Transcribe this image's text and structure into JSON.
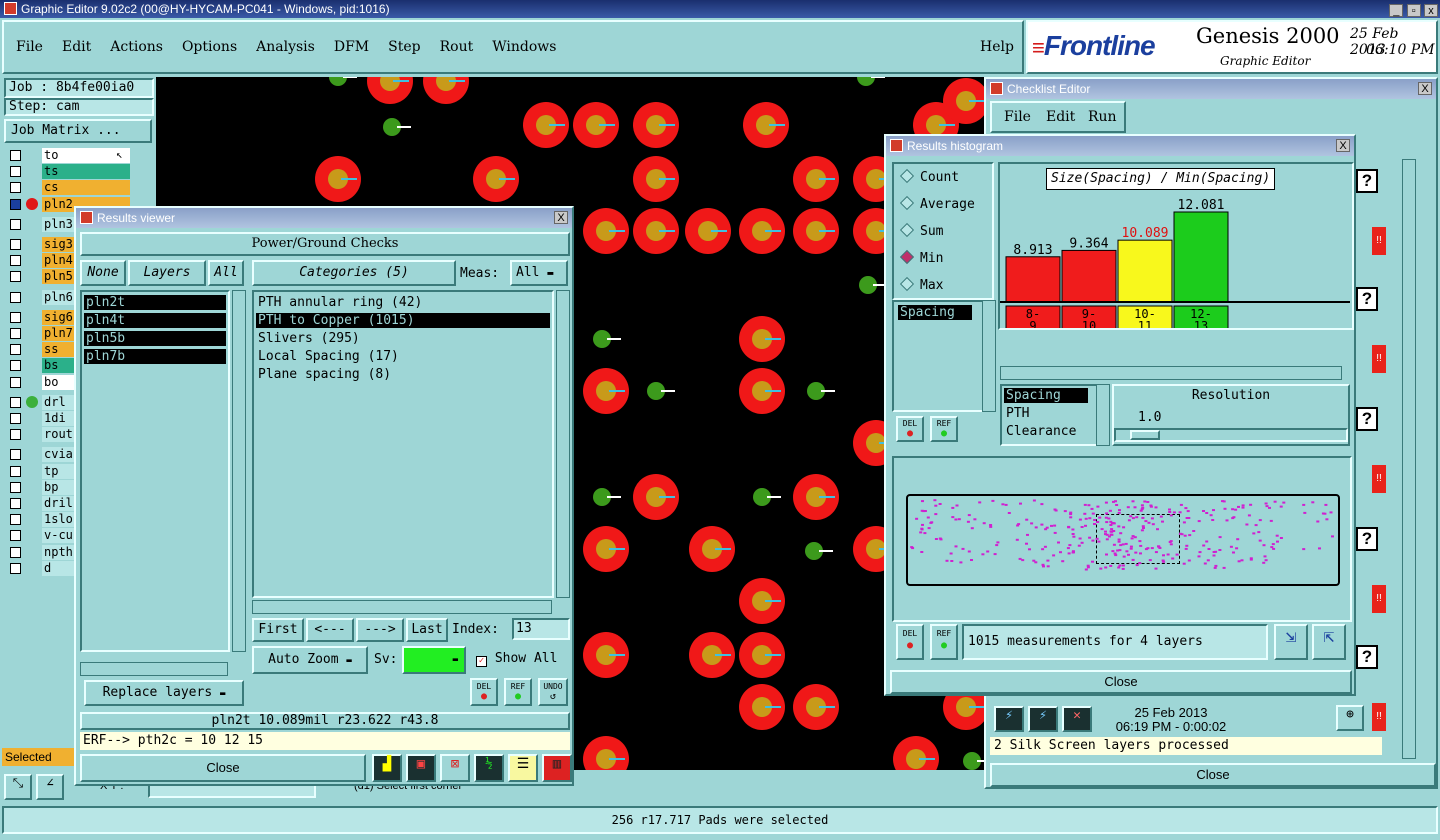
{
  "app": {
    "title": "Graphic Editor 9.02c2 (00@HY-HYCAM-PC041 - Windows, pid:1016)",
    "menu": [
      "File",
      "Edit",
      "Actions",
      "Options",
      "Analysis",
      "DFM",
      "Step",
      "Rout",
      "Windows"
    ],
    "help": "Help",
    "brand": "Frontline",
    "product": "Genesis 2000",
    "product_sub": "Graphic Editor",
    "date": "25 Feb 2013",
    "time": "06:10 PM"
  },
  "left_panel": {
    "job": "Job : 8b4fe00ia0",
    "step": "Step: cam",
    "job_matrix": "Job Matrix ...",
    "layers": [
      {
        "name": "to",
        "color": "#ffffff"
      },
      {
        "name": "ts",
        "color": "#2bb08a"
      },
      {
        "name": "cs",
        "color": "#f0b030"
      },
      {
        "name": "pln2",
        "color": "#f0b030"
      },
      {
        "name": "pln3",
        "color": "#b8e6e6"
      },
      {
        "name": "sig3",
        "color": "#f0b030"
      },
      {
        "name": "pln4",
        "color": "#f0b030"
      },
      {
        "name": "pln5",
        "color": "#f0b030"
      },
      {
        "name": "pln6",
        "color": "#b8e6e6"
      },
      {
        "name": "sig6",
        "color": "#f0b030"
      },
      {
        "name": "pln7",
        "color": "#f0b030"
      },
      {
        "name": "ss",
        "color": "#f0b030"
      },
      {
        "name": "bs",
        "color": "#2bb08a"
      },
      {
        "name": "bo",
        "color": "#ffffff"
      },
      {
        "name": "drl",
        "color": "#b8e6e6"
      },
      {
        "name": "1di",
        "color": "#b8e6e6"
      },
      {
        "name": "rout",
        "color": "#b8e6e6"
      },
      {
        "name": "cvia",
        "color": "#b8e6e6"
      },
      {
        "name": "tp",
        "color": "#b8e6e6"
      },
      {
        "name": "bp",
        "color": "#b8e6e6"
      },
      {
        "name": "dril",
        "color": "#b8e6e6"
      },
      {
        "name": "1slo",
        "color": "#b8e6e6"
      },
      {
        "name": "v-cu",
        "color": "#b8e6e6"
      },
      {
        "name": "npth",
        "color": "#b8e6e6"
      },
      {
        "name": "d",
        "color": "#b8e6e6"
      }
    ],
    "selected_label": "Selected"
  },
  "results_viewer": {
    "title": "Results viewer",
    "heading": "Power/Ground Checks",
    "none": "None",
    "layers": "Layers",
    "all": "All",
    "categories": "Categories (5)",
    "meas_label": "Meas:",
    "meas_value": "All",
    "layer_list": [
      "pln2t",
      "pln4t",
      "pln5b",
      "pln7b"
    ],
    "category_list": [
      "PTH annular ring (42)",
      "PTH to Copper (1015)",
      "Slivers (295)",
      "Local Spacing (17)",
      "Plane spacing (8)"
    ],
    "first": "First",
    "prev": "<---",
    "next": "--->",
    "last": "Last",
    "index_label": "Index:",
    "index_value": "13",
    "auto_zoom": "Auto Zoom",
    "sv_label": "Sv:",
    "show_all": "Show All",
    "replace_layers": "Replace layers",
    "del": "DEL",
    "ref": "REF",
    "undo": "UNDO",
    "status": "pln2t 10.089mil   r23.622  r43.8",
    "erf": "ERF--> pth2c = 10 12 15",
    "close": "Close"
  },
  "checklist_editor": {
    "title": "Checklist Editor",
    "menu": [
      "File",
      "Edit",
      "Run"
    ],
    "date": "25 Feb 2013",
    "time": "06:19 PM - 0:00:02",
    "status": "2 Silk Screen layers processed",
    "close": "Close"
  },
  "histogram": {
    "title": "Results histogram",
    "modes": [
      "Count",
      "Average",
      "Sum",
      "Min",
      "Max"
    ],
    "selected_mode": "Min",
    "measure_list": [
      "Spacing"
    ],
    "chart_title": "Size(Spacing) / Min(Spacing)",
    "del": "DEL",
    "ref": "REF",
    "type_list": [
      "Spacing",
      "PTH",
      "Clearance"
    ],
    "resolution_label": "Resolution",
    "resolution_value": "1.0",
    "summary": "1015 measurements for 4 layers",
    "close": "Close"
  },
  "chart_data": {
    "type": "bar",
    "title": "Size(Spacing) / Min(Spacing)",
    "categories": [
      "8-\n9",
      "9-\n10",
      "10-\n11",
      "12-\n13"
    ],
    "values": [
      8.913,
      9.364,
      10.089,
      12.081
    ],
    "colors": [
      "#f01c1c",
      "#f01c1c",
      "#f8f81c",
      "#1ccc1c"
    ],
    "value_colors": [
      "#000000",
      "#000000",
      "#e01010",
      "#000000"
    ]
  },
  "canvas": {
    "coord_label": "X Y :"
  },
  "status_bar": {
    "message": "256 r17.717 Pads were selected",
    "hint": "(d1) Select first corner"
  }
}
